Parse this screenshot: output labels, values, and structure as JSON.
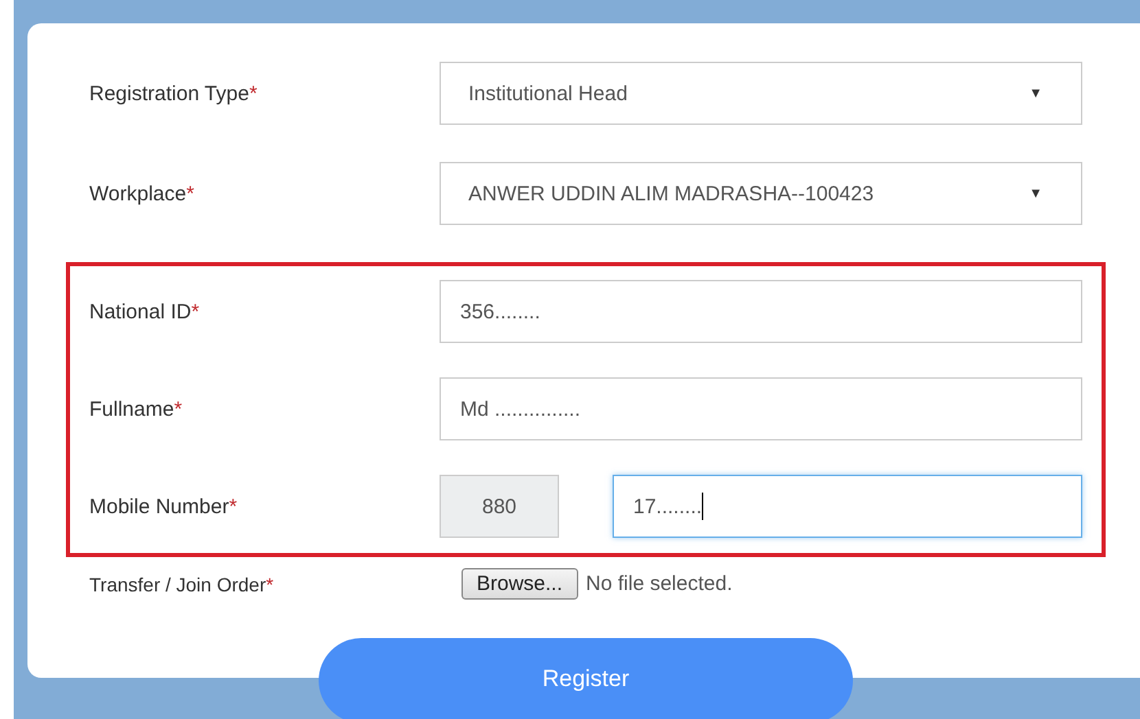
{
  "sections": [
    {
      "highlighted": false,
      "fields": [
        {
          "kind": "select",
          "label": "Registration Type",
          "required_mark": "*",
          "value": "Institutional Head",
          "caret": "▼"
        },
        {
          "kind": "select",
          "label": "Workplace",
          "required_mark": "*",
          "value": "ANWER UDDIN ALIM MADRASHA--100423",
          "caret": "▼"
        }
      ]
    },
    {
      "highlighted": true,
      "fields": [
        {
          "kind": "text",
          "label": "National ID",
          "required_mark": "*",
          "value": "356........",
          "focused": false
        },
        {
          "kind": "text",
          "label": "Fullname",
          "required_mark": "*",
          "value": "Md ...............",
          "focused": false
        },
        {
          "kind": "phone",
          "label": "Mobile Number",
          "required_mark": "*",
          "prefix": "880",
          "value": "17........",
          "focused": true
        }
      ]
    },
    {
      "highlighted": false,
      "fields": [
        {
          "kind": "file",
          "label": "Transfer / Join Order",
          "required_mark": "*",
          "button": "Browse...",
          "status": "No file selected."
        }
      ]
    }
  ],
  "submit": {
    "label": "Register"
  }
}
